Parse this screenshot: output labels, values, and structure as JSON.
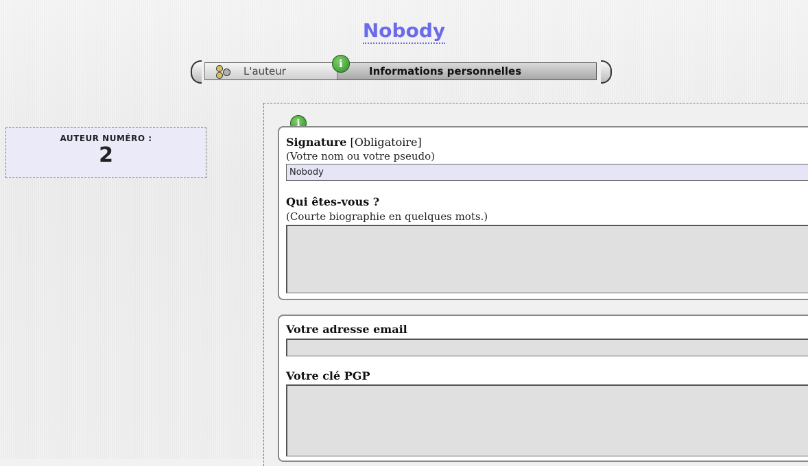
{
  "page": {
    "title": "Nobody"
  },
  "tabs": [
    {
      "label": "L'auteur",
      "icon": "authors-icon",
      "active": false
    },
    {
      "label": "Informations personnelles",
      "icon": "info-icon",
      "active": true
    }
  ],
  "author_box": {
    "label": "AUTEUR NUMÉRO :",
    "number": "2"
  },
  "form": {
    "signature": {
      "label": "Signature",
      "required": "[Obligatoire]",
      "hint": "(Votre nom ou votre pseudo)",
      "value": "Nobody"
    },
    "bio": {
      "label": "Qui êtes-vous ?",
      "hint": "(Courte biographie en quelques mots.)",
      "value": ""
    },
    "email": {
      "label": "Votre adresse email",
      "value": ""
    },
    "pgp": {
      "label": "Votre clé PGP",
      "value": ""
    }
  },
  "colors": {
    "title": "#6b6bea",
    "author_box_bg": "#ebeaf9",
    "signature_input_bg": "#e6e5f7",
    "info_icon": "#3a9a2e"
  }
}
